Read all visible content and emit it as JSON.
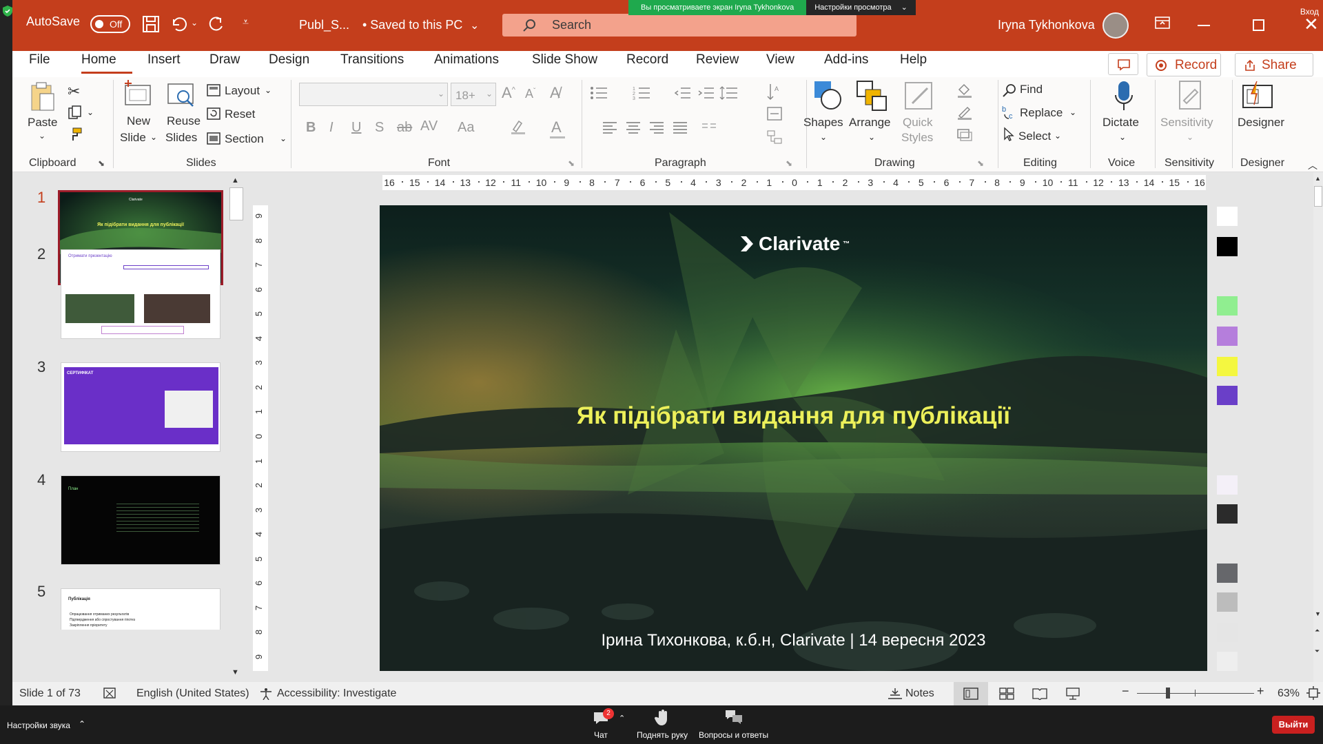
{
  "zoom_banner": {
    "viewing_text": "Вы просматриваете экран Iryna Tykhonkova",
    "settings_label": "Настройки просмотра"
  },
  "titlebar": {
    "autosave_label": "AutoSave",
    "autosave_state": "Off",
    "doc_title": "Publ_S...",
    "save_status": "• Saved to this PC",
    "search_placeholder": "Search",
    "user_name": "Iryna Tykhonkova",
    "sign_in": "Вход"
  },
  "ribbon_tabs": [
    "File",
    "Home",
    "Insert",
    "Draw",
    "Design",
    "Transitions",
    "Animations",
    "Slide Show",
    "Record",
    "Review",
    "View",
    "Add-ins",
    "Help"
  ],
  "ribbon_actions": {
    "record": "Record",
    "share": "Share"
  },
  "ribbon": {
    "clipboard": {
      "paste": "Paste",
      "group": "Clipboard"
    },
    "slides": {
      "new_slide_1": "New",
      "new_slide_2": "Slide",
      "reuse_1": "Reuse",
      "reuse_2": "Slides",
      "layout": "Layout",
      "reset": "Reset",
      "section": "Section",
      "group": "Slides"
    },
    "font": {
      "size_placeholder": "18+",
      "group": "Font"
    },
    "paragraph": {
      "group": "Paragraph"
    },
    "drawing": {
      "shapes": "Shapes",
      "arrange": "Arrange",
      "quick_1": "Quick",
      "quick_2": "Styles",
      "group": "Drawing"
    },
    "editing": {
      "find": "Find",
      "replace": "Replace",
      "select": "Select",
      "group": "Editing"
    },
    "voice": {
      "dictate": "Dictate",
      "group": "Voice"
    },
    "sensitivity": {
      "label": "Sensitivity",
      "group": "Sensitivity"
    },
    "designer": {
      "label": "Designer",
      "group": "Designer"
    }
  },
  "thumbnails": {
    "numbers": [
      "1",
      "2",
      "3",
      "4",
      "5"
    ],
    "t1_logo": "Clarivate",
    "t1_title": "Як підібрати видання для публікації",
    "t2_title": "Отримати презентацію",
    "t3_title": "СЕРТИФІКАТ",
    "t4_title": "План",
    "t5_title": "Публікація",
    "t5_items": [
      "Опрацювання отриманих результатів",
      "Підтвердження або спростування гіпотез",
      "Закріплення пріоритету"
    ]
  },
  "ruler_h": [
    "16",
    "15",
    "14",
    "13",
    "12",
    "11",
    "10",
    "9",
    "8",
    "7",
    "6",
    "5",
    "4",
    "3",
    "2",
    "1",
    "0",
    "1",
    "2",
    "3",
    "4",
    "5",
    "6",
    "7",
    "8",
    "9",
    "10",
    "11",
    "12",
    "13",
    "14",
    "15",
    "16"
  ],
  "ruler_v": [
    "9",
    "8",
    "7",
    "6",
    "5",
    "4",
    "3",
    "2",
    "1",
    "0",
    "1",
    "2",
    "3",
    "4",
    "5",
    "6",
    "7",
    "8",
    "9"
  ],
  "slide": {
    "logo": "Clarivate",
    "trademark": "™",
    "title": "Як підібрати видання для публікації",
    "subtitle": "Ірина Тихонкова, к.б.н, Clarivate | 14 вересня 2023"
  },
  "swatches": [
    "#ffffff",
    "#000000",
    "#90ee90",
    "#b57edc",
    "#f4f740",
    "#6a3fc8",
    "#f4f0f8",
    "#2b2b2b",
    "#66676b",
    "#bcbcbc",
    "#e5e5e5",
    "#eeeeee"
  ],
  "statusbar": {
    "slide_info": "Slide 1 of 73",
    "language": "English (United States)",
    "accessibility": "Accessibility: Investigate",
    "notes": "Notes",
    "zoom": "63%"
  },
  "zoombar": {
    "sound_settings": "Настройки звука",
    "chat": "Чат",
    "chat_badge": "2",
    "raise_hand": "Поднять руку",
    "qa": "Вопросы и ответы",
    "leave": "Выйти"
  },
  "colors": {
    "accent": "#c43e1c",
    "slide_title": "#ecf05a"
  }
}
